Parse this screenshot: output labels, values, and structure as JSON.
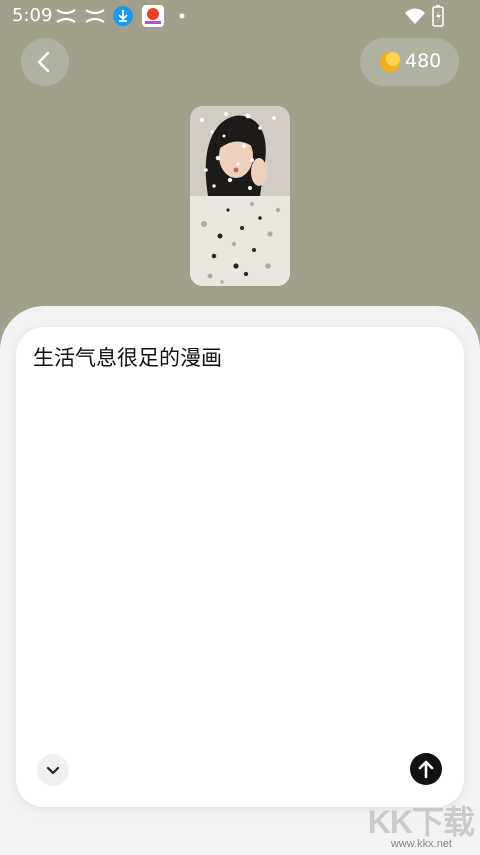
{
  "status_bar": {
    "time": "5:09"
  },
  "header": {
    "coin_count": "480"
  },
  "prompt": {
    "text": "生活气息很足的漫画"
  },
  "watermark": {
    "logo": "KK下载",
    "url": "www.kkx.net"
  },
  "colors": {
    "background": "#a0a08c",
    "sheet": "#f3f3f3",
    "card": "#ffffff",
    "send_button": "#111111",
    "coin": "#f5b019"
  },
  "icons": {
    "back": "chevron-left-icon",
    "coin": "coin-icon",
    "collapse": "chevron-down-icon",
    "send": "arrow-up-icon"
  }
}
